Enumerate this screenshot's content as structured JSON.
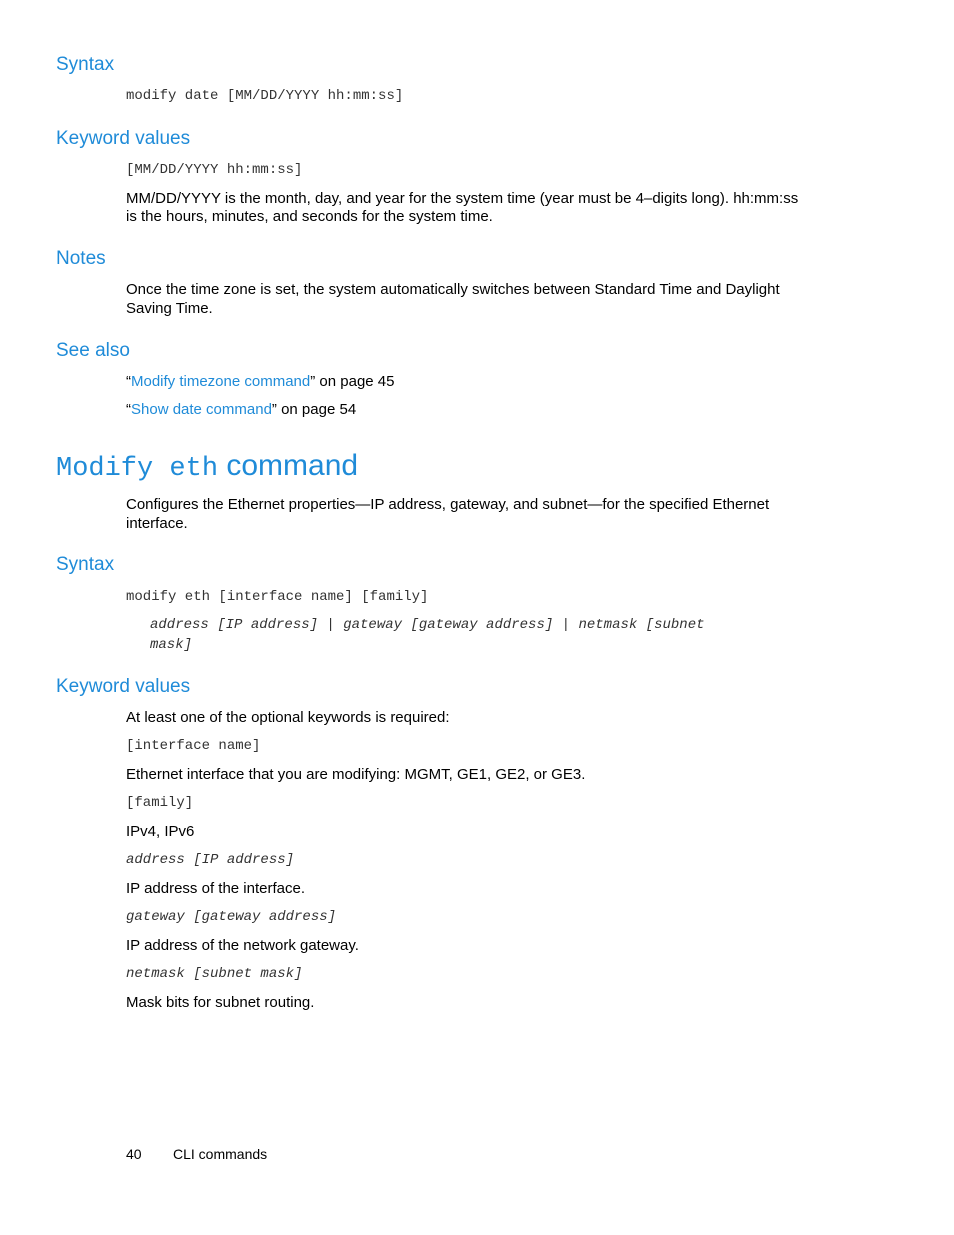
{
  "section1": {
    "syntax_heading": "Syntax",
    "syntax_code": "modify date [MM/DD/YYYY hh:mm:ss]",
    "keyword_heading": "Keyword values",
    "keyword_code": "[MM/DD/YYYY hh:mm:ss]",
    "keyword_desc_line1": "MM/DD/YYYY is the month, day, and year for the system time (year must be 4–digits long). hh:mm:ss",
    "keyword_desc_line2": "is the hours, minutes, and seconds for the system time.",
    "notes_heading": "Notes",
    "notes_line1": "Once the time zone is set, the system automatically switches between Standard Time and Daylight",
    "notes_line2": "Saving Time.",
    "see_also_heading": "See also",
    "see_also": [
      {
        "open_quote": "“",
        "link": "Modify timezone command",
        "suffix": "” on page 45"
      },
      {
        "open_quote": "“",
        "link": "Show date command",
        "suffix": "” on page 54"
      }
    ]
  },
  "section2": {
    "title_code": "Modify eth",
    "title_text": "command",
    "intro_line1": "Configures the Ethernet properties—IP address, gateway, and subnet—for the specified Ethernet",
    "intro_line2": "interface.",
    "syntax_heading": "Syntax",
    "syntax_code": "modify eth [interface name] [family]",
    "syntax_options_line1": "address [IP address] | gateway [gateway address] | netmask [subnet",
    "syntax_options_line2": "mask]",
    "keyword_heading": "Keyword values",
    "keyword_intro": "At least one of the optional keywords is required:",
    "keywords": [
      {
        "code": "[interface name]",
        "italic": false,
        "desc": "Ethernet interface that you are modifying: MGMT, GE1, GE2, or GE3."
      },
      {
        "code": "[family]",
        "italic": false,
        "desc": "IPv4, IPv6"
      },
      {
        "code": "address [IP address]",
        "italic": true,
        "desc": "IP address of the interface."
      },
      {
        "code": "gateway [gateway address]",
        "italic": true,
        "desc": "IP address of the network gateway."
      },
      {
        "code": "netmask [subnet mask]",
        "italic": true,
        "desc": "Mask bits for subnet routing."
      }
    ]
  },
  "footer": {
    "page_number": "40",
    "section_name": "CLI commands"
  }
}
